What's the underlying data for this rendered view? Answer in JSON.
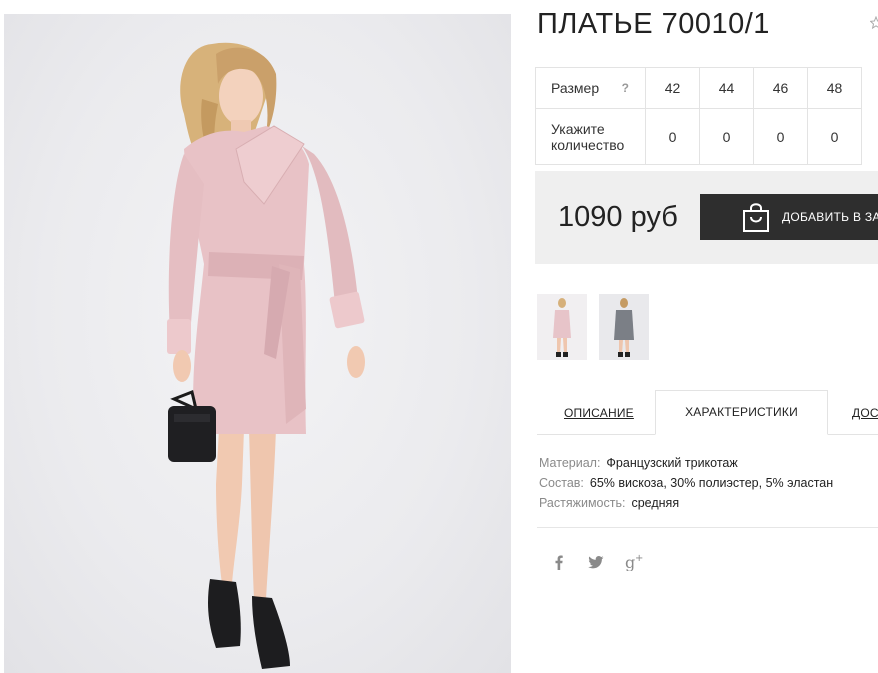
{
  "product": {
    "title": "ПЛАТЬЕ 70010/1",
    "image_alt": "pink-belted-wrap-dress-photo"
  },
  "sizes": {
    "size_label": "Размер",
    "help_mark": "?",
    "qty_label": "Укажите количество",
    "sizes": [
      "42",
      "44",
      "46",
      "48"
    ],
    "quantities": [
      "0",
      "0",
      "0",
      "0"
    ]
  },
  "purchase": {
    "price": "1090 руб",
    "add_to_cart_label": "ДОБАВИТЬ В ЗАКАЗ"
  },
  "thumbnails": [
    {
      "name": "thumbnail-pink-dress",
      "color": "#e7c4c9"
    },
    {
      "name": "thumbnail-grey-dress",
      "color": "#7b7f86"
    }
  ],
  "tabs": {
    "description": "ОПИСАНИЕ",
    "characteristics": "ХАРАКТЕРИСТИКИ",
    "delivery": "ДОСТАВКА",
    "active": "characteristics"
  },
  "specs": [
    {
      "key": "Материал:",
      "value": "Французский трикотаж"
    },
    {
      "key": "Состав:",
      "value": "65% вискоза, 30% полиэстер, 5% эластан"
    },
    {
      "key": "Растяжимость:",
      "value": "средняя"
    }
  ],
  "social": {
    "facebook": "f",
    "twitter": "twitter-icon",
    "googleplus": "g+"
  },
  "colors": {
    "accent_dark": "#2e2e2e",
    "price_box_bg": "#efefef",
    "dress_pink": "#e7c4c9",
    "border": "#e3e3e3"
  }
}
